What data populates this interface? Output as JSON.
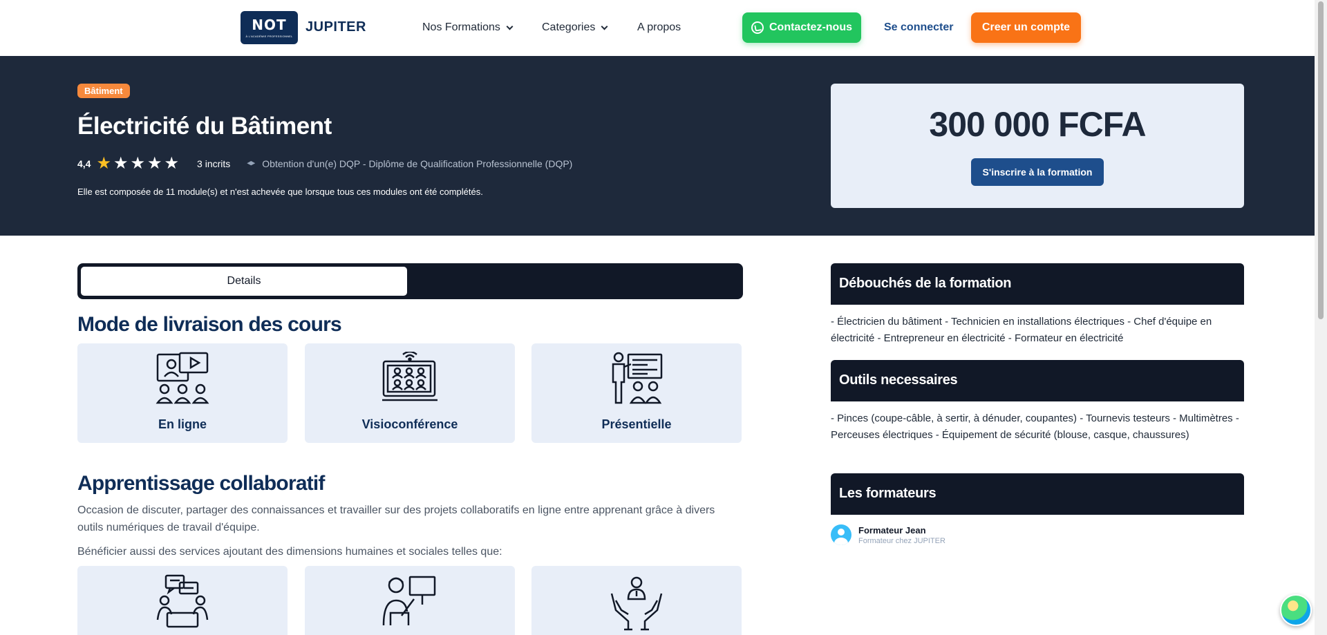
{
  "navbar": {
    "logo_text": "NOT",
    "logo_subtext": "À L'ACADÉMIE PROFESSIONNEL",
    "brand": "JUPITER",
    "menu": [
      {
        "label": "Nos Formations"
      },
      {
        "label": "Categories"
      },
      {
        "label": "A propos"
      }
    ],
    "contact_label": "Contactez-nous",
    "login_label": "Se connecter",
    "signup_label": "Creer un compte"
  },
  "course": {
    "category_badge": "Bâtiment",
    "title": "Électricité du Bâtiment",
    "rating": "4,4",
    "stars_total": 5,
    "stars_filled": 1,
    "enrolled": "3 incrits",
    "certification": "Obtention d'un(e) DQP - Diplôme de Qualification Professionnelle (DQP)",
    "description": "Elle est composée de 11 module(s) et n'est achevée que lorsque tous ces modules ont été complétés.",
    "price": "300 000 FCFA",
    "enroll_label": "S'inscrire à la formation"
  },
  "tabs": {
    "active": "Details"
  },
  "delivery": {
    "title": "Mode de livraison des cours",
    "modes": [
      {
        "label": "En ligne",
        "icon": "online-class-icon"
      },
      {
        "label": "Visioconférence",
        "icon": "video-conference-icon"
      },
      {
        "label": "Présentielle",
        "icon": "classroom-icon"
      }
    ]
  },
  "collab": {
    "title": "Apprentissage collaboratif",
    "paragraph": "Occasion de discuter, partager des connaissances et travailler sur des projets collaboratifs en ligne entre apprenant grâce à divers outils numériques de travail d'équipe.",
    "services_intro": "Bénéficier aussi des services ajoutant des dimensions humaines et sociales telles que:",
    "services": [
      {
        "icon": "discussion-icon"
      },
      {
        "icon": "mentor-presentation-icon"
      },
      {
        "icon": "support-hands-icon"
      }
    ]
  },
  "sidebar": {
    "outcomes_title": "Débouchés de la formation",
    "outcomes_text": "- Électricien du bâtiment - Technicien en installations électriques - Chef d'équipe en électricité - Entrepreneur en électricité - Formateur en électricité",
    "tools_title": "Outils necessaires",
    "tools_text": "- Pinces (coupe-câble, à sertir, à dénuder, coupantes) - Tournevis testeurs - Multimètres - Perceuses électriques - Équipement de sécurité (blouse, casque, chaussures)",
    "trainers_title": "Les formateurs",
    "trainer_name": "Formateur Jean",
    "trainer_role": "Formateur chez JUPITER"
  },
  "colors": {
    "navy": "#0f2d57",
    "hero_bg": "#1e293b",
    "orange": "#f97316",
    "green": "#22c55e",
    "card_bg": "#e8eef8"
  }
}
